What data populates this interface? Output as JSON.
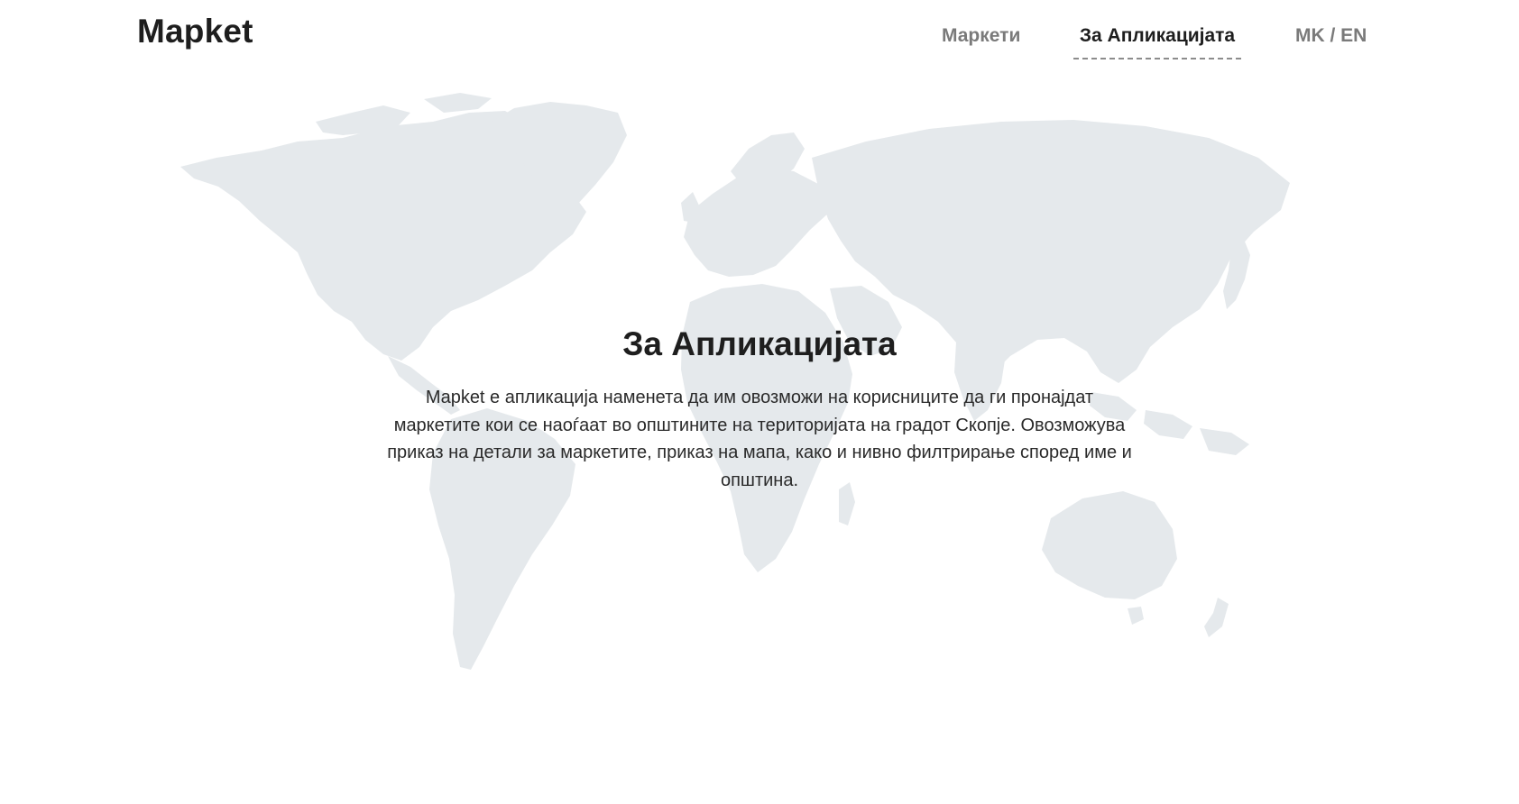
{
  "header": {
    "logo": "Mapket",
    "nav": {
      "markets": "Маркети",
      "about": "За Апликацијата",
      "language": "MK / EN"
    }
  },
  "main": {
    "title": "За Апликацијата",
    "description": "Mapket е апликација наменета да им овозможи на корисниците да ги пронајдат маркетите кои се наоѓаат во општините на територијата на градот Скопје. Овозможува приказ на детали за маркетите, приказ на мапа, како и нивно филтрирање според име и општина."
  },
  "colors": {
    "map_fill": "#e5e9ec",
    "text_dark": "#1e1e1e",
    "nav_inactive": "#7a7a7a",
    "background": "#ffffff"
  }
}
